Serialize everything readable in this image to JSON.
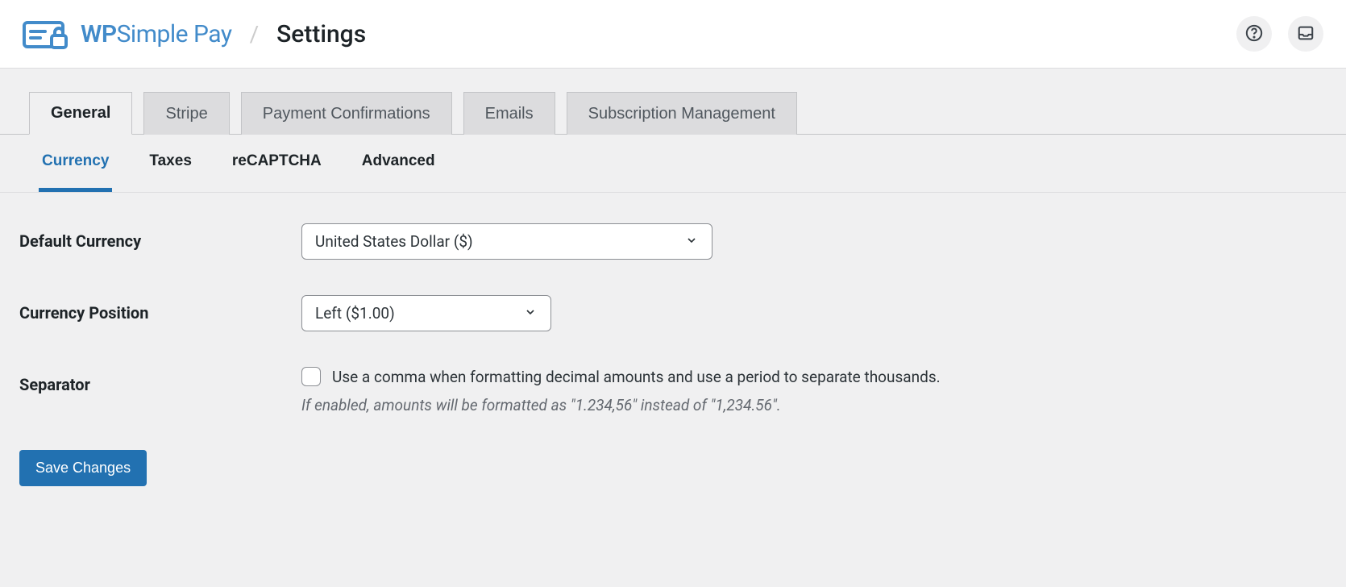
{
  "header": {
    "brand_bold": "WP",
    "brand_light": "Simple Pay",
    "page_title": "Settings"
  },
  "tabs_primary": [
    {
      "label": "General",
      "active": true
    },
    {
      "label": "Stripe",
      "active": false
    },
    {
      "label": "Payment Confirmations",
      "active": false
    },
    {
      "label": "Emails",
      "active": false
    },
    {
      "label": "Subscription Management",
      "active": false
    }
  ],
  "tabs_secondary": [
    {
      "label": "Currency",
      "active": true
    },
    {
      "label": "Taxes",
      "active": false
    },
    {
      "label": "reCAPTCHA",
      "active": false
    },
    {
      "label": "Advanced",
      "active": false
    }
  ],
  "form": {
    "default_currency": {
      "label": "Default Currency",
      "value": "United States Dollar ($)"
    },
    "currency_position": {
      "label": "Currency Position",
      "value": "Left ($1.00)"
    },
    "separator": {
      "label": "Separator",
      "checkbox_text": "Use a comma when formatting decimal amounts and use a period to separate thousands.",
      "help_text": "If enabled, amounts will be formatted as \"1.234,56\" instead of \"1,234.56\"."
    },
    "save_button": "Save Changes"
  }
}
